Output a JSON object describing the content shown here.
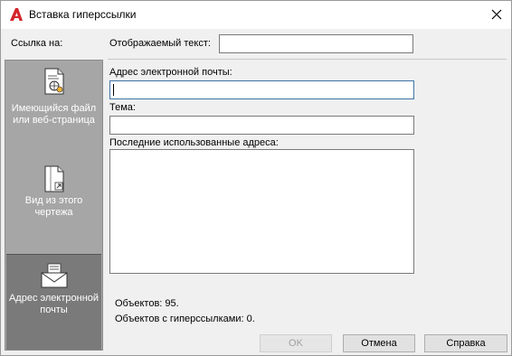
{
  "window": {
    "title": "Вставка гиперссылки",
    "app_icon": "autocad-a-icon",
    "close_icon": "close-icon"
  },
  "sidebar": {
    "header": "Ссылка на:",
    "items": [
      {
        "label": "Имеющийся файл или веб-страница",
        "icon": "file-web-icon",
        "selected": false
      },
      {
        "label": "Вид из этого чертежа",
        "icon": "drawing-view-icon",
        "selected": false
      },
      {
        "label": "Адрес электронной почты",
        "icon": "email-icon",
        "selected": true
      }
    ]
  },
  "form": {
    "display_text_label": "Отображаемый текст:",
    "display_text_value": "",
    "email_label": "Адрес электронной почты:",
    "email_value": "",
    "subject_label": "Тема:",
    "subject_value": "",
    "recent_label": "Последние использованные адреса:",
    "recent_items": []
  },
  "info": {
    "objects": "Объектов: 95.",
    "objects_with_links": "Объектов с гиперссылками: 0."
  },
  "buttons": {
    "ok": "OK",
    "cancel": "Отмена",
    "help": "Справка"
  },
  "colors": {
    "brand_red": "#d4242c",
    "sidebar_bg": "#a6a6a6",
    "sidebar_selected": "#7a7a7a",
    "focus_border": "#3f73a6"
  }
}
